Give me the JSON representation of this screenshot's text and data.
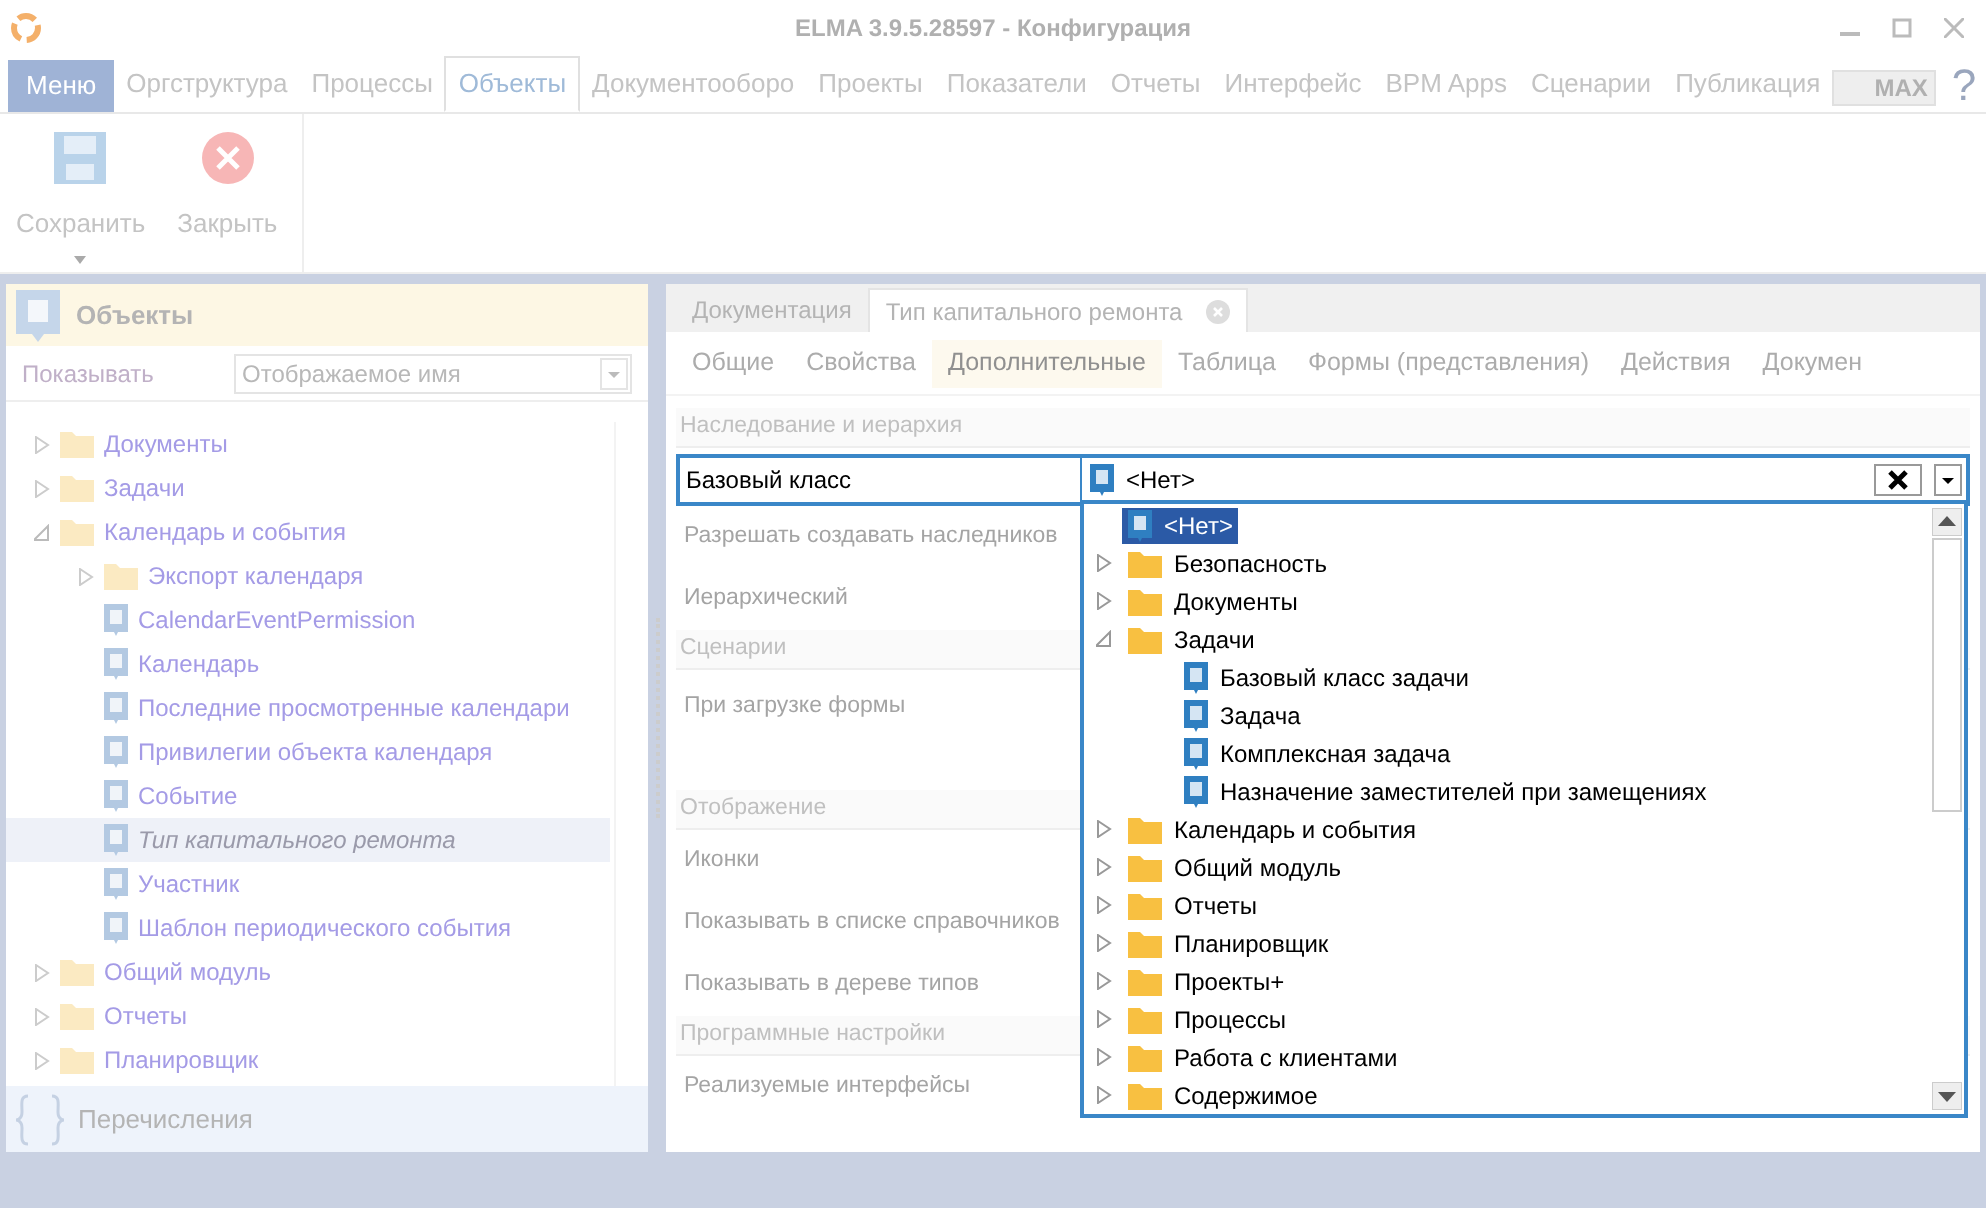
{
  "window": {
    "title": "ELMA 3.9.5.28597 - Конфигурация"
  },
  "menu_button": "Меню",
  "menu_tabs": [
    {
      "label": "Оргструктура",
      "selected": false
    },
    {
      "label": "Процессы",
      "selected": false
    },
    {
      "label": "Объекты",
      "selected": true
    },
    {
      "label": "Документооборо",
      "selected": false
    },
    {
      "label": "Проекты",
      "selected": false
    },
    {
      "label": "Показатели",
      "selected": false
    },
    {
      "label": "Отчеты",
      "selected": false
    },
    {
      "label": "Интерфейс",
      "selected": false
    },
    {
      "label": "BPM Apps",
      "selected": false
    },
    {
      "label": "Сценарии",
      "selected": false
    },
    {
      "label": "Публикация",
      "selected": false
    }
  ],
  "max_label": "MAX",
  "help": "?",
  "ribbon": [
    {
      "label": "Сохранить",
      "kind": "save"
    },
    {
      "label": "Закрыть",
      "kind": "close"
    }
  ],
  "left_panel": {
    "title": "Объекты",
    "show_label": "Показывать",
    "show_value": "Отображаемое имя",
    "tree": [
      {
        "label": "Документы",
        "kind": "folder",
        "expanded": false,
        "selected": false
      },
      {
        "label": "Задачи",
        "kind": "folder",
        "expanded": false,
        "selected": false
      },
      {
        "label": "Календарь и события",
        "kind": "folder",
        "expanded": true,
        "selected": false,
        "children": [
          {
            "label": "Экспорт календаря",
            "kind": "folder",
            "expanded": false,
            "selected": false
          },
          {
            "label": "CalendarEventPermission",
            "kind": "class",
            "selected": false
          },
          {
            "label": "Календарь",
            "kind": "class",
            "selected": false
          },
          {
            "label": "Последние просмотренные календари",
            "kind": "class",
            "selected": false
          },
          {
            "label": "Привилегии объекта календаря",
            "kind": "class",
            "selected": false
          },
          {
            "label": "Событие",
            "kind": "class",
            "selected": false
          },
          {
            "label": "Тип капитального ремонта",
            "kind": "class",
            "selected": true
          },
          {
            "label": "Участник",
            "kind": "class",
            "selected": false
          },
          {
            "label": "Шаблон периодического события",
            "kind": "class",
            "selected": false
          }
        ]
      },
      {
        "label": "Общий модуль",
        "kind": "folder",
        "expanded": false,
        "selected": false
      },
      {
        "label": "Отчеты",
        "kind": "folder",
        "expanded": false,
        "selected": false
      },
      {
        "label": "Планировщик",
        "kind": "folder",
        "expanded": false,
        "selected": false
      }
    ],
    "footer": "Перечисления"
  },
  "doc_tabs": [
    {
      "label": "Документация",
      "selected": false,
      "closable": false
    },
    {
      "label": "Тип капитального ремонта",
      "selected": true,
      "closable": true
    }
  ],
  "sub_tabs": [
    {
      "label": "Общие",
      "selected": false
    },
    {
      "label": "Свойства",
      "selected": false
    },
    {
      "label": "Дополнительные",
      "selected": true
    },
    {
      "label": "Таблица",
      "selected": false
    },
    {
      "label": "Формы (представления)",
      "selected": false
    },
    {
      "label": "Действия",
      "selected": false
    },
    {
      "label": "Докумен",
      "selected": false
    }
  ],
  "sections": [
    {
      "title": "Наследование и иерархия",
      "rows": [
        {
          "label": "Базовый класс",
          "kind": "field"
        },
        {
          "label": "Разрешать создавать наследников",
          "kind": "plain"
        },
        {
          "label": "Иерархический",
          "kind": "plain"
        }
      ]
    },
    {
      "title": "Сценарии",
      "rows": [
        {
          "label": "При загрузке формы",
          "kind": "tall"
        }
      ]
    },
    {
      "title": "Отображение",
      "rows": [
        {
          "label": "Иконки",
          "kind": "plain"
        },
        {
          "label": "Показывать в списке справочников",
          "kind": "plain"
        },
        {
          "label": "Показывать в дереве типов",
          "kind": "plain"
        }
      ]
    },
    {
      "title": "Программные настройки",
      "rows": [
        {
          "label": "Реализуемые интерфейсы",
          "kind": "plain"
        }
      ]
    }
  ],
  "base_class": {
    "value": "<Нет>",
    "dropdown": [
      {
        "label": "<Нет>",
        "kind": "class",
        "selected": true
      },
      {
        "label": "Безопасность",
        "kind": "folder",
        "expanded": false,
        "selected": false
      },
      {
        "label": "Документы",
        "kind": "folder",
        "expanded": false,
        "selected": false
      },
      {
        "label": "Задачи",
        "kind": "folder",
        "expanded": true,
        "selected": false,
        "children": [
          {
            "label": "Базовый класс задачи",
            "kind": "class",
            "selected": false
          },
          {
            "label": "Задача",
            "kind": "class",
            "selected": false
          },
          {
            "label": "Комплексная задача",
            "kind": "class",
            "selected": false
          },
          {
            "label": "Назначение заместителей при замещениях",
            "kind": "class",
            "selected": false
          }
        ]
      },
      {
        "label": "Календарь и события",
        "kind": "folder",
        "expanded": false,
        "selected": false
      },
      {
        "label": "Общий модуль",
        "kind": "folder",
        "expanded": false,
        "selected": false
      },
      {
        "label": "Отчеты",
        "kind": "folder",
        "expanded": false,
        "selected": false
      },
      {
        "label": "Планировщик",
        "kind": "folder",
        "expanded": false,
        "selected": false
      },
      {
        "label": "Проекты+",
        "kind": "folder",
        "expanded": false,
        "selected": false
      },
      {
        "label": "Процессы",
        "kind": "folder",
        "expanded": false,
        "selected": false
      },
      {
        "label": "Работа с клиентами",
        "kind": "folder",
        "expanded": false,
        "selected": false
      },
      {
        "label": "Содержимое",
        "kind": "folder",
        "expanded": false,
        "selected": false
      }
    ]
  }
}
